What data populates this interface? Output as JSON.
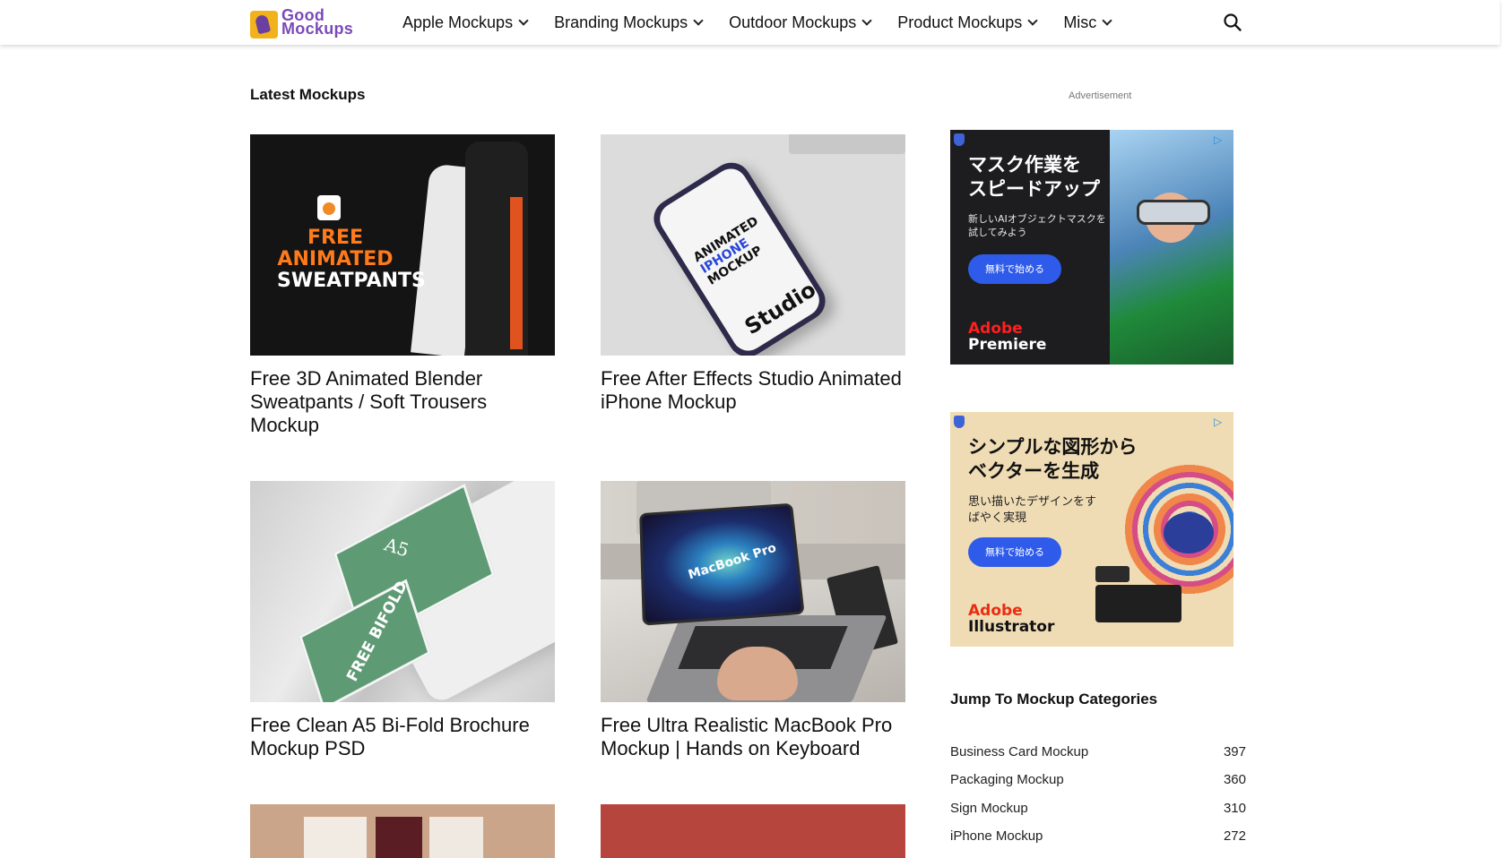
{
  "header": {
    "logo_line1": "Good",
    "logo_line2": "Mockups",
    "nav": [
      {
        "label": "Apple Mockups"
      },
      {
        "label": "Branding Mockups"
      },
      {
        "label": "Outdoor Mockups"
      },
      {
        "label": "Product Mockups"
      },
      {
        "label": "Misc"
      }
    ]
  },
  "main": {
    "section_title": "Latest Mockups",
    "cards": [
      {
        "title": "Free 3D Animated Blender Sweatpants / Soft Trousers Mockup",
        "art_line1": "FREE ANIMATED",
        "art_line2": "SWEATPANTS"
      },
      {
        "title": "Free After Effects Studio Animated iPhone Mockup",
        "art_line1": "ANIMATED",
        "art_line2": "IPHONE",
        "art_line3": "MOCKUP",
        "art_line4": "Studio"
      },
      {
        "title": "Free Clean A5 Bi-Fold Brochure Mockup PSD",
        "art_line1": "A5",
        "art_line2": "FREE BIFOLD"
      },
      {
        "title": "Free Ultra Realistic MacBook Pro Mockup | Hands on Keyboard",
        "art_line1": "MacBook Pro"
      },
      {
        "title": ""
      },
      {
        "title": ""
      }
    ]
  },
  "sidebar": {
    "ad_label": "Advertisement",
    "ads": [
      {
        "headline_1": "マスク作業を",
        "headline_2": "スピードアップ",
        "sub": "新しいAIオブジェクトマスクを試してみよう",
        "cta": "無料で始める",
        "brand_1": "Adobe",
        "brand_2": "Premiere"
      },
      {
        "headline_1": "シンプルな図形から",
        "headline_2": "ベクターを生成",
        "sub": "思い描いたデザインをすばやく実現",
        "cta": "無料で始める",
        "brand_1": "Adobe",
        "brand_2": "Illustrator"
      }
    ],
    "categories_title": "Jump To Mockup Categories",
    "categories": [
      {
        "name": "Business Card Mockup",
        "count": "397"
      },
      {
        "name": "Packaging Mockup",
        "count": "360"
      },
      {
        "name": "Sign Mockup",
        "count": "310"
      },
      {
        "name": "iPhone Mockup",
        "count": "272"
      }
    ]
  },
  "colors": {
    "logo_purple": "#7a4bb7",
    "logo_yellow": "#f2b21b",
    "ad_button_blue": "#2f5bea",
    "adobe_red": "#ff1f1f"
  }
}
